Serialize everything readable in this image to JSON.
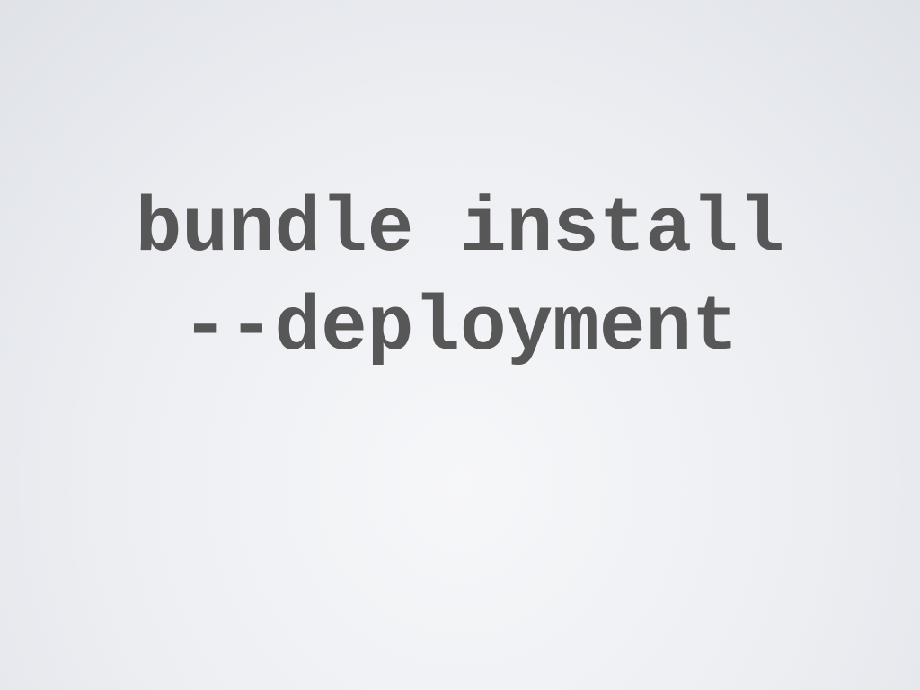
{
  "slide": {
    "lines": [
      "bundle install",
      "--deployment"
    ]
  },
  "colors": {
    "text": "#575757",
    "background": "#eceef2"
  }
}
